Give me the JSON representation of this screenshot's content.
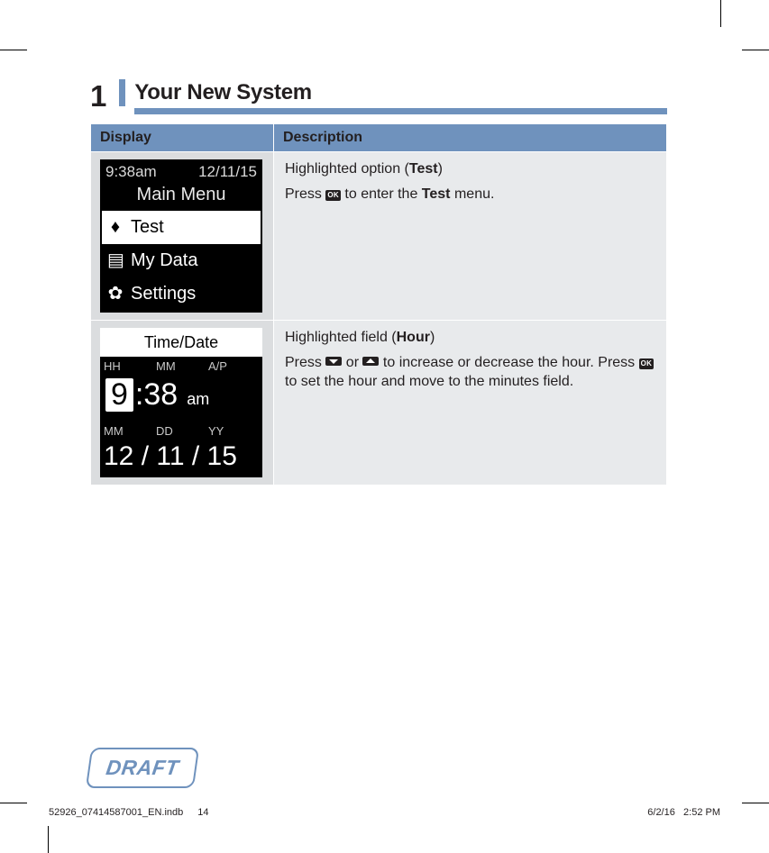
{
  "chapter": {
    "number": "1",
    "title": "Your New System"
  },
  "table": {
    "headers": {
      "display": "Display",
      "description": "Description"
    },
    "rows": [
      {
        "lcd": {
          "time": "9:38am",
          "date": "12/11/15",
          "title": "Main Menu",
          "items": [
            {
              "icon": "droplet",
              "label": "Test",
              "active": true
            },
            {
              "icon": "data",
              "label": "My Data",
              "active": false
            },
            {
              "icon": "gear",
              "label": "Settings",
              "active": false
            }
          ]
        },
        "desc": {
          "line1_pre": "Highlighted option (",
          "line1_bold": "Test",
          "line1_post": ")",
          "line2_pre": "Press ",
          "line2_ok": "OK",
          "line2_mid": " to enter the ",
          "line2_bold": "Test",
          "line2_post": " menu."
        }
      },
      {
        "lcd": {
          "title": "Time/Date",
          "row1_labels": {
            "a": "HH",
            "b": "MM",
            "c": "A/P"
          },
          "time": {
            "hh": "9",
            "sep": ":",
            "mm": "38",
            "ampm": "am"
          },
          "row2_labels": {
            "a": "MM",
            "b": "DD",
            "c": "YY"
          },
          "date": "12 / 11 / 15"
        },
        "desc": {
          "line1_pre": "Highlighted field (",
          "line1_bold": "Hour",
          "line1_post": ")",
          "line2_pre": "Press ",
          "line2_mid1": " or ",
          "line2_mid2": " to increase or decrease the hour. Press ",
          "line2_ok": "OK",
          "line2_post": " to set the hour and move to the minutes field."
        }
      }
    ]
  },
  "draft": "DRAFT",
  "footer": {
    "file": "52926_07414587001_EN.indb",
    "page": "14",
    "date": "6/2/16",
    "time": "2:52 PM"
  }
}
